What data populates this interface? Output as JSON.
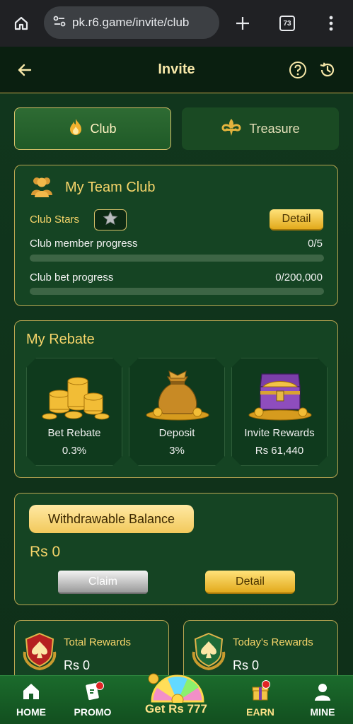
{
  "browser": {
    "url": "pk.r6.game/invite/club",
    "tab_count": "73"
  },
  "header": {
    "title": "Invite"
  },
  "tabs": [
    {
      "label": "Club",
      "active": true
    },
    {
      "label": "Treasure",
      "active": false
    }
  ],
  "team_club": {
    "title": "My Team Club",
    "stars_label": "Club Stars",
    "detail_label": "Detail",
    "member_progress_label": "Club member progress",
    "member_progress_value": "0/5",
    "member_progress_fraction": 0,
    "bet_progress_label": "Club bet progress",
    "bet_progress_value": "0/200,000",
    "bet_progress_fraction": 0
  },
  "rebate": {
    "title": "My Rebate",
    "items": [
      {
        "name": "Bet Rebate",
        "value": "0.3%"
      },
      {
        "name": "Deposit",
        "value": "3%"
      },
      {
        "name": "Invite Rewards",
        "value": "Rs 61,440"
      }
    ]
  },
  "balance": {
    "badge": "Withdrawable Balance",
    "amount": "Rs 0",
    "claim_label": "Claim",
    "detail_label": "Detail"
  },
  "rewards": {
    "total_label": "Total Rewards",
    "total_value": "Rs 0",
    "today_label": "Today's Rewards",
    "today_value": "Rs 0"
  },
  "nav": {
    "home": "HOME",
    "promo": "PROMO",
    "center": "Get Rs 777",
    "earn": "EARN",
    "mine": "MINE"
  },
  "colors": {
    "accent_gold": "#f6d56a",
    "background": "#11361d",
    "nav_green": "#1b6b2c"
  }
}
